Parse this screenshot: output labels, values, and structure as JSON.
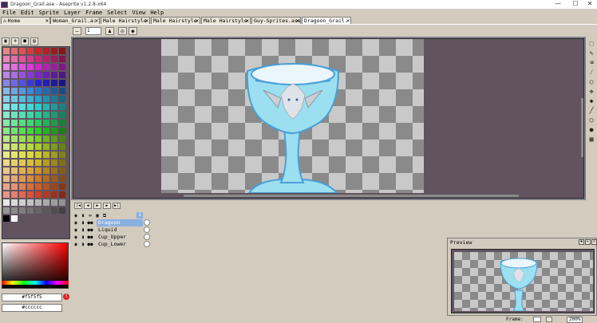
{
  "window": {
    "title": "Dragoon_Grail.ase - Aseprite v1.2.8-x64",
    "controls": [
      "—",
      "☐",
      "✕"
    ]
  },
  "menu": [
    "File",
    "Edit",
    "Sprite",
    "Layer",
    "Frame",
    "Select",
    "View",
    "Help"
  ],
  "tabs": [
    {
      "label": "Home",
      "active": false
    },
    {
      "label": "Woman_Grail.a:",
      "active": false
    },
    {
      "label": "Male Hairstyle",
      "active": false
    },
    {
      "label": "Male Hairstyle :",
      "active": false
    },
    {
      "label": "Male Hairstyle",
      "active": false
    },
    {
      "label": "Guy-Sprites.ase",
      "active": false
    },
    {
      "label": "Dragoon_Grail.",
      "active": true
    }
  ],
  "context": {
    "brush_size": "1"
  },
  "colors": {
    "fg_hex": "#f5f5f5",
    "bg_hex": "#cccccc"
  },
  "layers": [
    {
      "name": "Dragoon",
      "selected": true
    },
    {
      "name": "Liquid",
      "selected": false
    },
    {
      "name": "Cup_Upper",
      "selected": false
    },
    {
      "name": "Cup_Lower",
      "selected": false
    }
  ],
  "frame_number": "1",
  "preview": {
    "title": "Preview"
  },
  "status": {
    "frame_label": "Frame:",
    "zoom": "200%"
  },
  "icons": {
    "tools": [
      "marquee-icon",
      "pencil-icon",
      "eraser-icon",
      "eyedropper-icon",
      "zoom-icon",
      "move-icon",
      "bucket-icon",
      "line-icon",
      "ellipse-icon",
      "blur-icon",
      "ink-icon"
    ]
  }
}
